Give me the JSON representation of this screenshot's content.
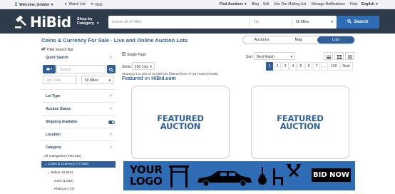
{
  "topbar": {
    "welcome": "Welcome, Gridder",
    "watch_list": "Watch List",
    "bids": "Bids",
    "find_auctions": "Find Auctions",
    "blog": "Blog",
    "sell": "Sell",
    "mailing_list": "Join Our Mailing List",
    "manage_notifications": "Manage Notifications",
    "help": "Help",
    "language": "English"
  },
  "header": {
    "logo": "HiBid",
    "shop_line1": "Shop by",
    "shop_line2": "Category",
    "search_placeholder": "Search all of HiBid",
    "zip_placeholder": "Zip",
    "miles": "50 Miles",
    "search_button": "Search"
  },
  "page": {
    "title": "Coins & Currency For Sale - Live and Online Auction Lots",
    "tabs": [
      "Auctions",
      "Map",
      "Lots"
    ]
  },
  "sidebar": {
    "hide_search_bar": "Hide Search Bar",
    "quick_search": "Quick Search",
    "search_placeholder": "Search",
    "zip_placeholder": "Zip Code",
    "miles": "50 Miles",
    "lot_type": "Lot Type",
    "auction_status": "Auction Status",
    "shipping_available": "Shipping Available",
    "location": "Location",
    "category": "Category",
    "all_categories": "All Categories (790,142)",
    "active_category": "Coins & Currency (77,458)",
    "bullion": "Bullion (5,816)",
    "gold": "Gold (1,946)",
    "platinum": "Platinum (37)"
  },
  "results": {
    "single_page": "Single Page",
    "sort_label": "Sort",
    "sort_value": "Best Match",
    "show_label": "Show:",
    "show_value": "100 Lots",
    "pages": [
      "1",
      "2",
      "3",
      "4",
      "5",
      "6",
      "7",
      "...",
      "100",
      "Next"
    ],
    "showing_text": "Showing 1 to 100 of 10,000 lots (filtered from 77,457 total records)",
    "featured_on_prefix": "Featured",
    "featured_on_suffix": "on",
    "featured_on_brand": "HiBid.com",
    "featured_card_line1": "FEATURED",
    "featured_card_line2": "AUCTION"
  },
  "banner": {
    "line1": "YOUR",
    "line2": "LOGO",
    "cta": "BID NOW"
  },
  "colors": {
    "header_bg": "#2e3b4b",
    "brand_blue": "#2e5f99",
    "search_blue": "#2e6db5",
    "banner_blue": "#2e6db5"
  }
}
